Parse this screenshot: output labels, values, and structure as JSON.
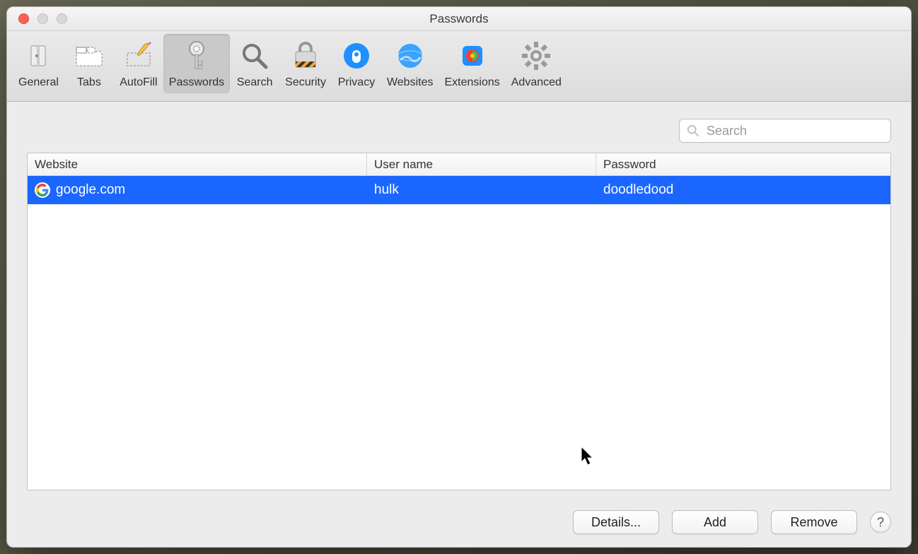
{
  "window": {
    "title": "Passwords"
  },
  "toolbar": {
    "items": [
      {
        "id": "general",
        "label": "General"
      },
      {
        "id": "tabs",
        "label": "Tabs"
      },
      {
        "id": "autofill",
        "label": "AutoFill"
      },
      {
        "id": "passwords",
        "label": "Passwords"
      },
      {
        "id": "search",
        "label": "Search"
      },
      {
        "id": "security",
        "label": "Security"
      },
      {
        "id": "privacy",
        "label": "Privacy"
      },
      {
        "id": "websites",
        "label": "Websites"
      },
      {
        "id": "extensions",
        "label": "Extensions"
      },
      {
        "id": "advanced",
        "label": "Advanced"
      }
    ],
    "active": "passwords"
  },
  "search": {
    "placeholder": "Search",
    "value": ""
  },
  "table": {
    "columns": {
      "website": "Website",
      "username": "User name",
      "password": "Password"
    },
    "rows": [
      {
        "website": "google.com",
        "username": "hulk",
        "password": "doodledood",
        "selected": true
      }
    ]
  },
  "buttons": {
    "details": "Details...",
    "add": "Add",
    "remove": "Remove"
  }
}
